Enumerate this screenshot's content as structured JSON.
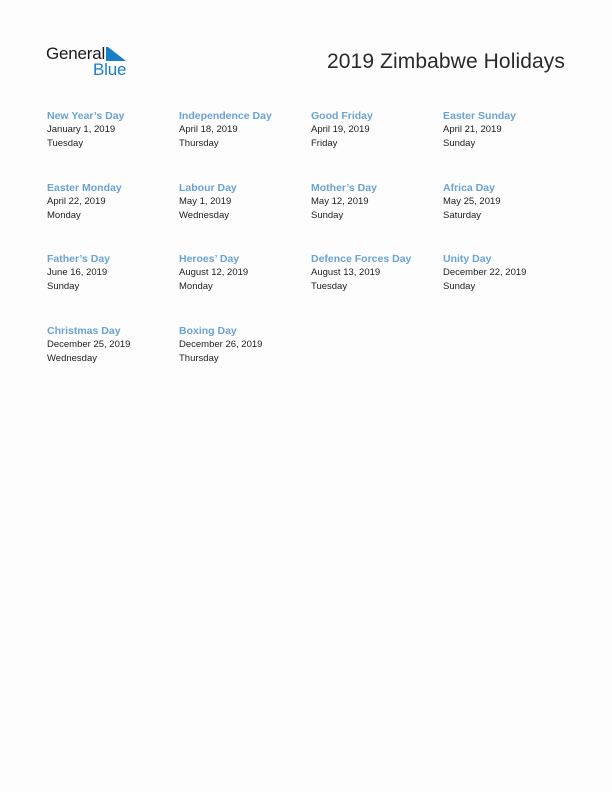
{
  "logo": {
    "line1": "General",
    "line2": "Blue",
    "accent_color": "#1a7fc7"
  },
  "title": "2019 Zimbabwe Holidays",
  "colors": {
    "holiday_name": "#6aa3d5",
    "text": "#1e1e1e"
  },
  "holidays": [
    {
      "name": "New Year’s Day",
      "date": "January 1, 2019",
      "weekday": "Tuesday"
    },
    {
      "name": "Independence Day",
      "date": "April 18, 2019",
      "weekday": "Thursday"
    },
    {
      "name": "Good Friday",
      "date": "April 19, 2019",
      "weekday": "Friday"
    },
    {
      "name": "Easter Sunday",
      "date": "April 21, 2019",
      "weekday": "Sunday"
    },
    {
      "name": "Easter Monday",
      "date": "April 22, 2019",
      "weekday": "Monday"
    },
    {
      "name": "Labour Day",
      "date": "May 1, 2019",
      "weekday": "Wednesday"
    },
    {
      "name": "Mother’s Day",
      "date": "May 12, 2019",
      "weekday": "Sunday"
    },
    {
      "name": "Africa Day",
      "date": "May 25, 2019",
      "weekday": "Saturday"
    },
    {
      "name": "Father’s Day",
      "date": "June 16, 2019",
      "weekday": "Sunday"
    },
    {
      "name": "Heroes’ Day",
      "date": "August 12, 2019",
      "weekday": "Monday"
    },
    {
      "name": "Defence Forces Day",
      "date": "August 13, 2019",
      "weekday": "Tuesday"
    },
    {
      "name": "Unity Day",
      "date": "December 22, 2019",
      "weekday": "Sunday"
    },
    {
      "name": "Christmas Day",
      "date": "December 25, 2019",
      "weekday": "Wednesday"
    },
    {
      "name": "Boxing Day",
      "date": "December 26, 2019",
      "weekday": "Thursday"
    }
  ]
}
